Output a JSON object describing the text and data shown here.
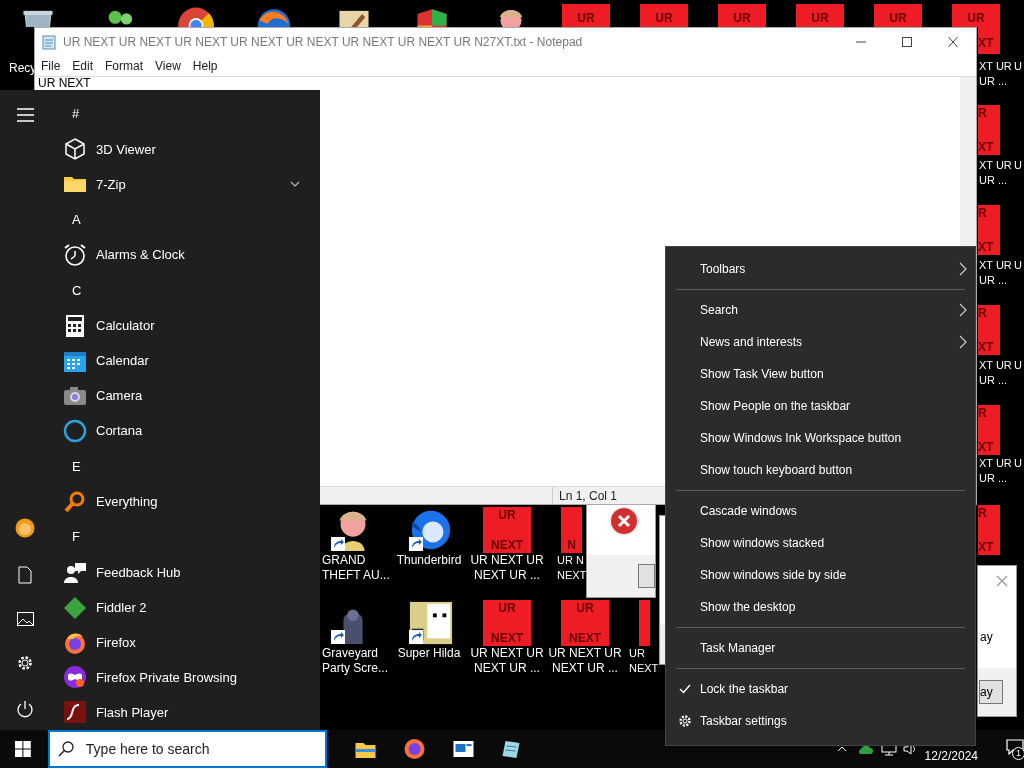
{
  "desktop": {
    "top_icons": [
      {
        "kind": "recycle-bin",
        "label": "Recy"
      },
      {
        "kind": "people"
      },
      {
        "kind": "chrome"
      },
      {
        "kind": "browser"
      },
      {
        "kind": "paint"
      },
      {
        "kind": "shield"
      },
      {
        "kind": "character"
      },
      {
        "kind": "tile",
        "tile_text": "UR"
      },
      {
        "kind": "tile",
        "tile_text": "UR"
      },
      {
        "kind": "tile",
        "tile_text": "UR"
      },
      {
        "kind": "tile",
        "tile_text": "UR"
      },
      {
        "kind": "tile",
        "tile_text": "UR"
      },
      {
        "kind": "tile",
        "tile_text": "UR",
        "tile_text_2": "XT"
      }
    ],
    "right_strip": [
      {
        "tile_top": "R",
        "tile_bottom": "XT"
      },
      {
        "tile_top": "R",
        "tile_bottom": "XT"
      },
      {
        "tile_top": "R",
        "tile_bottom": "XT"
      },
      {
        "tile_top": "R",
        "tile_bottom": "XT"
      },
      {
        "tile_top": "R",
        "tile_bottom": "XT"
      }
    ],
    "right_labels": [
      {
        "lines": [
          "XT UR",
          "UR ..."
        ],
        "edge_text": "U"
      },
      {
        "lines": [
          "XT UR",
          "UR ..."
        ],
        "edge_text": "U"
      },
      {
        "lines": [
          "XT UR",
          "UR ..."
        ],
        "edge_text": "U"
      },
      {
        "lines": [
          "XT UR",
          "UR ..."
        ],
        "edge_text": "U"
      },
      {
        "lines": [
          "XT UR",
          "UR ..."
        ],
        "edge_text": "U"
      }
    ],
    "bottom_icons": [
      {
        "kind": "character",
        "lines": [
          "GRAND",
          "THEFT AU..."
        ],
        "shortcut": true
      },
      {
        "kind": "bird",
        "lines": [
          "Thunderbird"
        ],
        "shortcut": true
      },
      {
        "kind": "tile",
        "tile_top": "UR",
        "tile_bottom": "NEXT",
        "lines": [
          "UR NEXT UR",
          "NEXT UR ..."
        ],
        "shortcut": false
      },
      {
        "kind": "tile",
        "tile_bottom": "N",
        "lines": [
          "UR N",
          "NEXT"
        ],
        "shortcut": false
      },
      {
        "kind": "ghost",
        "lines": [
          "Graveyard",
          "Party Scre..."
        ],
        "shortcut": true
      },
      {
        "kind": "pixel",
        "lines": [
          "Super Hilda"
        ],
        "shortcut": true
      },
      {
        "kind": "tile",
        "tile_top": "UR",
        "tile_bottom": "NEXT",
        "lines": [
          "UR NEXT UR",
          "NEXT UR ..."
        ],
        "shortcut": false
      },
      {
        "kind": "tile",
        "tile_top": "UR",
        "tile_bottom": "NEXT",
        "lines": [
          "UR NEXT UR",
          "NEXT UR ..."
        ],
        "shortcut": false
      },
      {
        "kind": "tile",
        "lines": [
          "UR",
          "NEXT"
        ],
        "shortcut": false
      }
    ]
  },
  "notepad": {
    "title": "UR NEXT UR NEXT UR NEXT UR NEXT UR NEXT UR NEXT UR NEXT UR N27XT.txt - Notepad",
    "menu": [
      "File",
      "Edit",
      "Format",
      "View",
      "Help"
    ],
    "text": "UR NEXT",
    "status": "Ln 1, Col 1"
  },
  "dialogs": [
    {
      "kind": "error"
    },
    {
      "kind": "blank"
    },
    {
      "kind": "message",
      "text": "ay",
      "button": "ay"
    }
  ],
  "start_menu": {
    "items": [
      {
        "kind": "header",
        "label": "#"
      },
      {
        "kind": "app",
        "label": "3D Viewer",
        "expandable": false
      },
      {
        "kind": "app",
        "label": "7-Zip",
        "expandable": true
      },
      {
        "kind": "header",
        "label": "A"
      },
      {
        "kind": "app",
        "label": "Alarms & Clock",
        "expandable": false
      },
      {
        "kind": "header",
        "label": "C"
      },
      {
        "kind": "app",
        "label": "Calculator",
        "expandable": false
      },
      {
        "kind": "app",
        "label": "Calendar",
        "expandable": false
      },
      {
        "kind": "app",
        "label": "Camera",
        "expandable": false
      },
      {
        "kind": "app",
        "label": "Cortana",
        "expandable": false
      },
      {
        "kind": "header",
        "label": "E"
      },
      {
        "kind": "app",
        "label": "Everything",
        "expandable": false
      },
      {
        "kind": "header",
        "label": "F"
      },
      {
        "kind": "app",
        "label": "Feedback Hub",
        "expandable": false
      },
      {
        "kind": "app",
        "label": "Fiddler 2",
        "expandable": false
      },
      {
        "kind": "app",
        "label": "Firefox",
        "expandable": false
      },
      {
        "kind": "app",
        "label": "Firefox Private Browsing",
        "expandable": false
      },
      {
        "kind": "app",
        "label": "Flash Player",
        "expandable": false
      }
    ]
  },
  "context_menu": {
    "items": [
      {
        "kind": "item",
        "label": "Toolbars",
        "submenu": true,
        "checked": false
      },
      {
        "kind": "separator"
      },
      {
        "kind": "item",
        "label": "Search",
        "submenu": true,
        "checked": false
      },
      {
        "kind": "item",
        "label": "News and interests",
        "submenu": true,
        "checked": false
      },
      {
        "kind": "item",
        "label": "Show Task View button",
        "submenu": false,
        "checked": false
      },
      {
        "kind": "item",
        "label": "Show People on the taskbar",
        "submenu": false,
        "checked": false
      },
      {
        "kind": "item",
        "label": "Show Windows Ink Workspace button",
        "submenu": false,
        "checked": false
      },
      {
        "kind": "item",
        "label": "Show touch keyboard button",
        "submenu": false,
        "checked": false
      },
      {
        "kind": "separator"
      },
      {
        "kind": "item",
        "label": "Cascade windows",
        "submenu": false,
        "checked": false
      },
      {
        "kind": "item",
        "label": "Show windows stacked",
        "submenu": false,
        "checked": false
      },
      {
        "kind": "item",
        "label": "Show windows side by side",
        "submenu": false,
        "checked": false
      },
      {
        "kind": "item",
        "label": "Show the desktop",
        "submenu": false,
        "checked": false
      },
      {
        "kind": "separator"
      },
      {
        "kind": "item",
        "label": "Task Manager",
        "submenu": false,
        "checked": false
      },
      {
        "kind": "separator"
      },
      {
        "kind": "item",
        "label": "Lock the taskbar",
        "submenu": false,
        "checked": true
      },
      {
        "kind": "settings",
        "label": "Taskbar settings",
        "submenu": false,
        "checked": false
      }
    ]
  },
  "taskbar": {
    "search_placeholder": "Type here to search",
    "date": "12/2/2024",
    "notification_count": "1"
  }
}
